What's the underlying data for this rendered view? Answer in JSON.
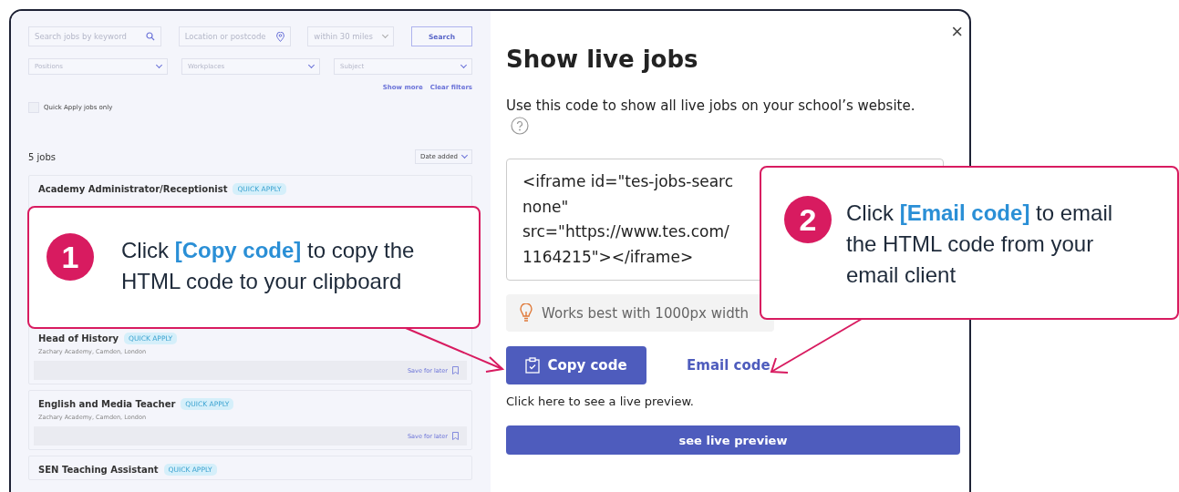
{
  "search_bar": {
    "keyword_placeholder": "Search jobs by keyword",
    "location_placeholder": "Location or postcode",
    "radius": "within 30 miles",
    "search_button": "Search"
  },
  "filters": [
    {
      "placeholder": "Positions"
    },
    {
      "placeholder": "Workplaces"
    },
    {
      "placeholder": "Subject"
    }
  ],
  "filter_links": [
    "Show more",
    "Clear filters"
  ],
  "quick_apply_filter": {
    "label": "Quick Apply jobs only",
    "checked": false
  },
  "results": {
    "count": "5 jobs",
    "sort": "Date added"
  },
  "jobs": [
    {
      "title": "Academy Administrator/Receptionist",
      "badge": "QUICK APPLY"
    },
    {
      "title": "Head of History",
      "badge": "QUICK APPLY",
      "location": "Zachary Academy, Camden, London",
      "save": "Save for later"
    },
    {
      "title": "English and Media Teacher",
      "badge": "QUICK APPLY",
      "location": "Zachary Academy, Camden, London",
      "save": "Save for later"
    },
    {
      "title": "SEN Teaching Assistant",
      "badge": "QUICK APPLY"
    }
  ],
  "modal": {
    "close": "×",
    "title": "Show live jobs",
    "description": "Use this code to show all live jobs on your school’s website.",
    "code_lines": [
      "<iframe id=\"tes-jobs-searc",
      "none\"",
      "src=\"https://www.tes.com/",
      "1164215\"></iframe>"
    ],
    "tip": "Works best with 1000px width",
    "copy_button": "Copy code",
    "email_link": "Email code",
    "preview_hint": "Click here to see a live preview.",
    "preview_button": "see live preview"
  },
  "callouts": [
    {
      "number": "1",
      "text": "Click **[Copy code]** to copy the HTML code to your clipboard"
    },
    {
      "number": "2",
      "text": "Click **[Email code]** to email the HTML code from your email client"
    }
  ]
}
